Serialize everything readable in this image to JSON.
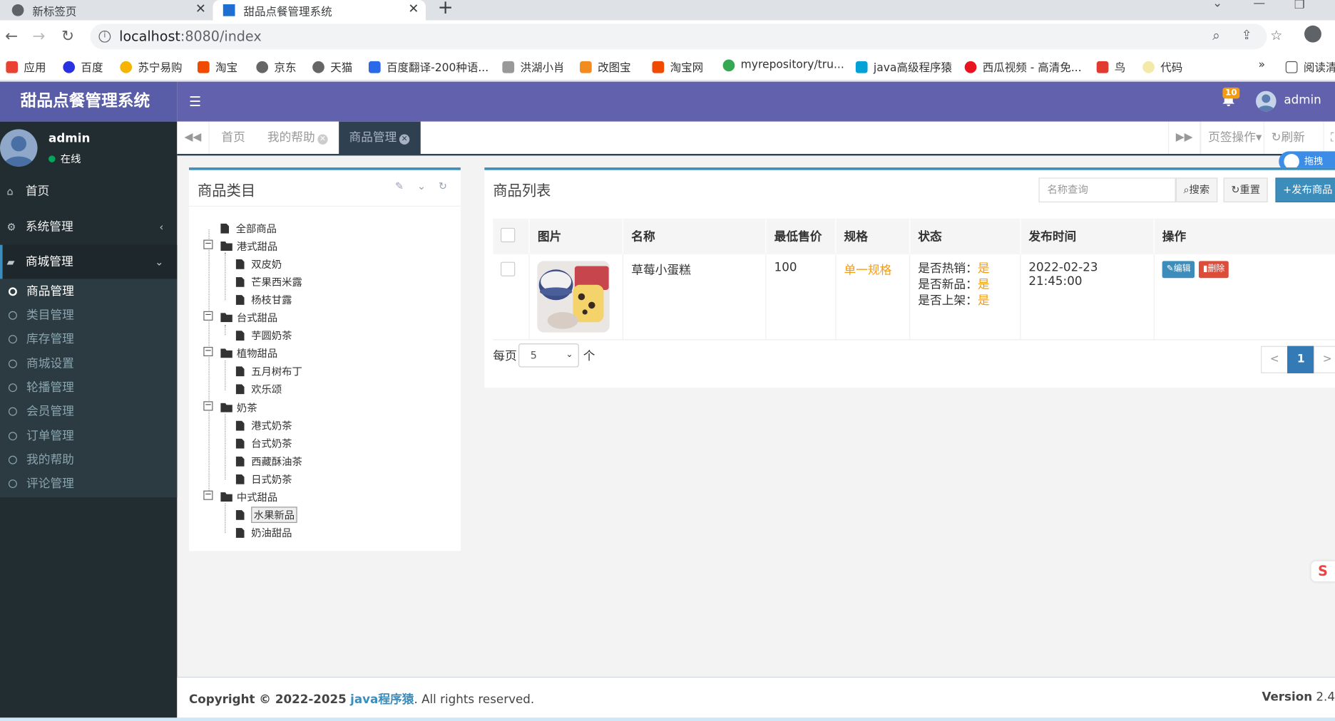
{
  "browser": {
    "tabs": [
      {
        "title": "新标签页"
      },
      {
        "title": "甜品点餐管理系统"
      }
    ],
    "url_host": "localhost",
    "url_rest": ":8080/index",
    "bookmarks": [
      "应用",
      "百度",
      "苏宁易购",
      "淘宝",
      "京东",
      "天猫",
      "百度翻译-200种语...",
      "洪湖小肖",
      "改图宝",
      "淘宝网",
      "myrepository/tru...",
      "java高级程序猿",
      "西瓜视频 - 高清免...",
      "鸟",
      "代码"
    ],
    "more": "»",
    "reading_list": "阅读清"
  },
  "app": {
    "title": "甜品点餐管理系统",
    "notification_count": "10",
    "user": "admin"
  },
  "sidebar": {
    "user": {
      "name": "admin",
      "status": "在线"
    },
    "menu": [
      {
        "label": "首页"
      },
      {
        "label": "系统管理"
      },
      {
        "label": "商城管理"
      }
    ],
    "submenu": [
      "商品管理",
      "类目管理",
      "库存管理",
      "商城设置",
      "轮播管理",
      "会员管理",
      "订单管理",
      "我的帮助",
      "评论管理"
    ]
  },
  "pagetabs": {
    "tabs": [
      "首页",
      "我的帮助",
      "商品管理"
    ],
    "page_ops": "页签操作",
    "refresh": "刷新",
    "cloud_label": "拖拽"
  },
  "category_panel": {
    "title": "商品类目",
    "tree": [
      {
        "label": "全部商品"
      },
      {
        "label": "港式甜品"
      },
      {
        "label": "双皮奶"
      },
      {
        "label": "芒果西米露"
      },
      {
        "label": "杨枝甘露"
      },
      {
        "label": "台式甜品"
      },
      {
        "label": "芋圆奶茶"
      },
      {
        "label": "植物甜品"
      },
      {
        "label": "五月树布丁"
      },
      {
        "label": "欢乐颂"
      },
      {
        "label": "奶茶"
      },
      {
        "label": "港式奶茶"
      },
      {
        "label": "台式奶茶"
      },
      {
        "label": "西藏酥油茶"
      },
      {
        "label": "日式奶茶"
      },
      {
        "label": "中式甜品"
      },
      {
        "label": "水果新品"
      },
      {
        "label": "奶油甜品"
      }
    ]
  },
  "product_panel": {
    "title": "商品列表",
    "search_placeholder": "名称查询",
    "search_btn": "搜索",
    "reset_btn": "重置",
    "publish_btn": "发布商品",
    "columns": [
      "图片",
      "名称",
      "最低售价",
      "规格",
      "状态",
      "发布时间",
      "操作"
    ],
    "rows": [
      {
        "name": "草莓小蛋糕",
        "min_price": "100",
        "spec": "单一规格",
        "status": [
          {
            "label": "是否热销：",
            "value": "是"
          },
          {
            "label": "是否新品：",
            "value": "是"
          },
          {
            "label": "是否上架：",
            "value": "是"
          }
        ],
        "publish_time": "2022-02-23 21:45:00",
        "edit": "编辑",
        "delete": "删除"
      }
    ],
    "per_page_label": "每页",
    "per_page_value": "5",
    "per_page_unit": "个",
    "pager": {
      "prev": "<",
      "current": "1",
      "next": ">"
    }
  },
  "footer": {
    "copyright_prefix": "Copyright © 2022-2025",
    "brand": "java程序猿",
    "rights": ". All rights reserved.",
    "version_label": "Version",
    "version": "2.4"
  },
  "colors": {
    "header": "#6261ad",
    "logo_bg": "#595ca6",
    "sidebar": "#222d32",
    "accent": "#3c8dbc",
    "danger": "#dd4b39",
    "orange": "#f39c12"
  }
}
